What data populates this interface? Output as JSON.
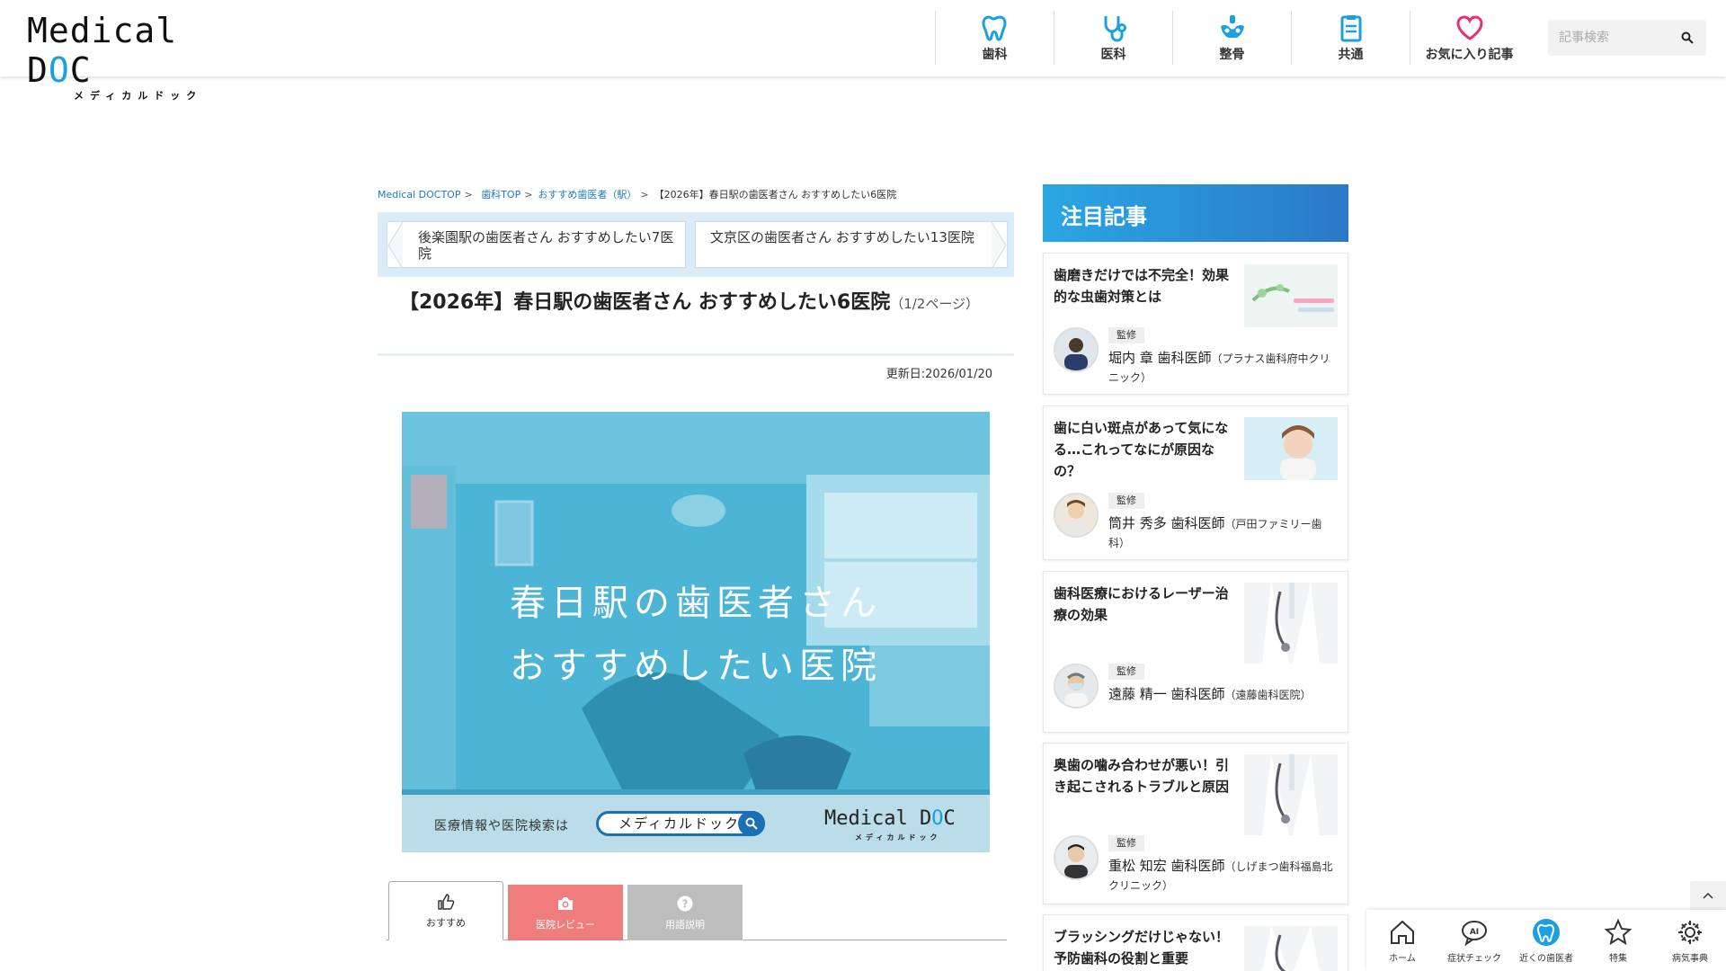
{
  "header": {
    "logo_main_1": "Medical D",
    "logo_main_dot": "O",
    "logo_main_2": "C",
    "logo_sub": "メディカルドック",
    "nav": [
      {
        "label": "歯科",
        "icon": "tooth-icon"
      },
      {
        "label": "医科",
        "icon": "stethoscope-icon"
      },
      {
        "label": "整骨",
        "icon": "pelvis-icon"
      },
      {
        "label": "共通",
        "icon": "clipboard-icon"
      },
      {
        "label": "お気に入り記事",
        "icon": "heart-icon"
      }
    ],
    "search_placeholder": "記事検索"
  },
  "breadcrumb": {
    "items": [
      "Medical DOCTOP",
      "歯科TOP",
      "おすすめ歯医者（駅）"
    ],
    "current": "【2026年】春日駅の歯医者さん おすすめしたい6医院",
    "separator": ">"
  },
  "related": {
    "prev": "後楽園駅の歯医者さん おすすめしたい7医院",
    "next": "文京区の歯医者さん おすすめしたい13医院"
  },
  "article": {
    "title": "【2026年】春日駅の歯医者さん おすすめしたい6医院",
    "page_info": "（1/2ページ）",
    "updated": "更新日:2026/01/20"
  },
  "hero": {
    "line1": "春日駅の歯医者さん",
    "line2": "おすすめしたい医院",
    "bar_text": "医療情報や医院検索は",
    "pill_text": "メディカルドック",
    "logo_1": "Medical D",
    "logo_dot": "O",
    "logo_2": "C",
    "logo_sub": "メディカルドック"
  },
  "tabs": [
    {
      "label": "おすすめ",
      "icon": "thumbs-up-icon"
    },
    {
      "label": "医院レビュー",
      "icon": "camera-icon"
    },
    {
      "label": "用語説明",
      "icon": "question-icon"
    }
  ],
  "sidebar": {
    "heading": "注目記事",
    "badge": "監修",
    "articles": [
      {
        "title": "歯磨きだけでは不完全！効果的な虫歯対策とは",
        "name": "堀内 章 歯科医師",
        "clinic": "（プラナス歯科府中クリニック）"
      },
      {
        "title": "歯に白い斑点があって気になる…これってなにが原因なの？",
        "name": "筒井 秀多 歯科医師",
        "clinic": "（戸田ファミリー歯科）"
      },
      {
        "title": "歯科医療におけるレーザー治療の効果",
        "name": "遠藤 精一 歯科医師",
        "clinic": "（遠藤歯科医院）"
      },
      {
        "title": "奥歯の噛み合わせが悪い！引き起こされるトラブルと原因",
        "name": "重松 知宏 歯科医師",
        "clinic": "（しげまつ歯科福島北クリニック）"
      },
      {
        "title": "ブラッシングだけじゃない！予防歯科の役割と重要"
      }
    ]
  },
  "bottom_nav": [
    {
      "label": "ホーム",
      "icon": "home-icon"
    },
    {
      "label": "症状チェック",
      "icon": "ai-chat-icon"
    },
    {
      "label": "近くの歯医者",
      "icon": "tooth-icon"
    },
    {
      "label": "特集",
      "icon": "star-icon"
    },
    {
      "label": "病気事典",
      "icon": "gear-icon"
    }
  ],
  "colors": {
    "brand_blue": "#1aa0e0",
    "review_tab": "#f07d7d",
    "glossary_tab": "#bdbdbd",
    "favorite_pink": "#e8306e"
  }
}
